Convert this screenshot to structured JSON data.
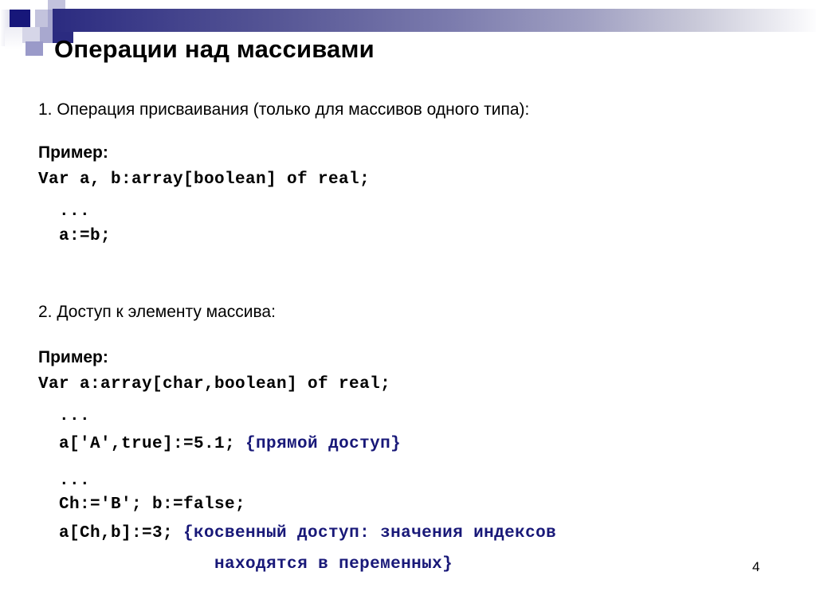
{
  "slide": {
    "title": "Операции над массивами",
    "page_number": "4",
    "accent_color": "#2b2b80",
    "comment_color": "#181878"
  },
  "header": {
    "decoration_icon": "mosaic-squares-icon",
    "gradient_from": "#2b2b80",
    "gradient_to": "#fdfdfe"
  },
  "sections": [
    {
      "heading": "1. Операция  присваивания (только для массивов одного типа):",
      "example_label": "Пример:",
      "code": [
        "Var a, b:array[boolean] of real;",
        "  ...",
        "  a:=b;"
      ]
    },
    {
      "heading": "2. Доступ к элементу массива:",
      "example_label": "Пример:",
      "code": [
        "Var a:array[char,boolean] of real;",
        "  ...",
        "  a['A',true]:=5.1; ",
        "  ...",
        "  Ch:='B'; b:=false;",
        "  a[Ch,b]:=3; "
      ],
      "comments": {
        "direct_access": "{прямой доступ}",
        "indirect_access_line1": "{косвенный доступ: значения индексов",
        "indirect_access_line2": "находятся в переменных}"
      }
    }
  ]
}
